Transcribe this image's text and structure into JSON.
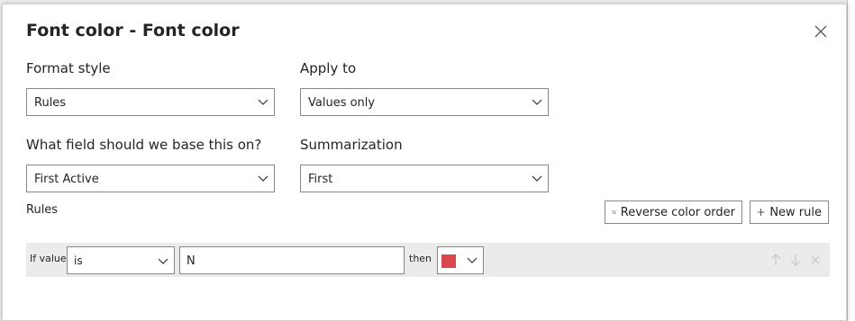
{
  "dialog": {
    "title": "Font color - Font color"
  },
  "format_style": {
    "label": "Format style",
    "selected": "Rules"
  },
  "apply_to": {
    "label": "Apply to",
    "selected": "Values only"
  },
  "base_field": {
    "label": "What field should we base this on?",
    "selected": "First Active"
  },
  "summarization": {
    "label": "Summarization",
    "selected": "First"
  },
  "rules": {
    "label": "Rules",
    "reverse_label": "Reverse color order",
    "new_rule_label": "New rule",
    "row": {
      "if_value_label": "If value",
      "operator": "is",
      "value": "N",
      "then_label": "then",
      "color": "#d9464e"
    }
  },
  "colors": {
    "border": "#8a8886",
    "row_bg": "#edebe9",
    "disabled_icon": "#c8c6c4"
  }
}
